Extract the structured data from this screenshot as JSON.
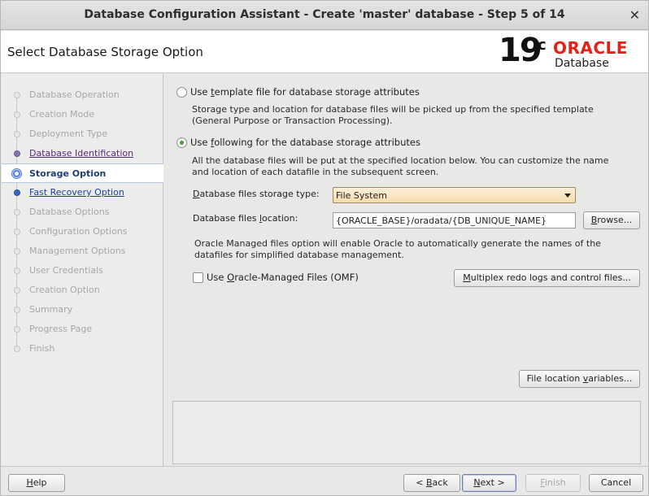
{
  "window": {
    "title": "Database Configuration Assistant - Create 'master' database - Step 5 of 14",
    "close_glyph": "✕"
  },
  "header": {
    "page_title": "Select Database Storage Option",
    "logo": {
      "version": "19",
      "version_sup": "c",
      "brand": "ORACLE",
      "product": "Database"
    }
  },
  "sidebar": {
    "items": [
      {
        "label": "Database Operation",
        "state": "done"
      },
      {
        "label": "Creation Mode",
        "state": "done"
      },
      {
        "label": "Deployment Type",
        "state": "done"
      },
      {
        "label": "Database Identification",
        "state": "link"
      },
      {
        "label": "Storage Option",
        "state": "active"
      },
      {
        "label": "Fast Recovery Option",
        "state": "link"
      },
      {
        "label": "Database Options",
        "state": "disabled"
      },
      {
        "label": "Configuration Options",
        "state": "disabled"
      },
      {
        "label": "Management Options",
        "state": "disabled"
      },
      {
        "label": "User Credentials",
        "state": "disabled"
      },
      {
        "label": "Creation Option",
        "state": "disabled"
      },
      {
        "label": "Summary",
        "state": "disabled"
      },
      {
        "label": "Progress Page",
        "state": "disabled"
      },
      {
        "label": "Finish",
        "state": "disabled"
      }
    ]
  },
  "content": {
    "option_template": {
      "label_pre": "Use ",
      "label_mn": "t",
      "label_post": "emplate file for database storage attributes",
      "desc_line1": "Storage type and location for database files will be picked up from the specified template",
      "desc_line2": "(General Purpose or Transaction Processing).",
      "selected": false
    },
    "option_following": {
      "label_pre": "Use ",
      "label_mn": "f",
      "label_post": "ollowing for the database storage attributes",
      "desc_line1": "All the database files will be put at the specified location below. You can customize the name",
      "desc_line2": "and location of each datafile in the subsequent screen.",
      "selected": true
    },
    "storage_type": {
      "label_pre": "",
      "label_mn": "D",
      "label_post": "atabase files storage type:",
      "value": "File System"
    },
    "files_location": {
      "label_pre": "Database files ",
      "label_mn": "l",
      "label_post": "ocation:",
      "value": "{ORACLE_BASE}/oradata/{DB_UNIQUE_NAME}"
    },
    "browse_button": {
      "label_pre": "",
      "label_mn": "B",
      "label_post": "rowse..."
    },
    "omf_note": {
      "line1": "Oracle Managed files option will enable Oracle to automatically generate the names of the",
      "line2": "datafiles for simplified database management."
    },
    "omf_checkbox": {
      "label_pre": "Use ",
      "label_mn": "O",
      "label_post": "racle-Managed Files (OMF)",
      "checked": false
    },
    "multiplex_button": {
      "label_pre": "",
      "label_mn": "M",
      "label_post": "ultiplex redo logs and control files..."
    },
    "file_location_vars_button": {
      "label_pre": "File location ",
      "label_mn": "v",
      "label_post": "ariables..."
    }
  },
  "footer": {
    "help": {
      "label_pre": "",
      "label_mn": "H",
      "label_post": "elp"
    },
    "back": {
      "label_pre": "< ",
      "label_mn": "B",
      "label_post": "ack"
    },
    "next": {
      "label_pre": "",
      "label_mn": "N",
      "label_post": "ext >"
    },
    "finish": {
      "label_pre": "",
      "label_mn": "F",
      "label_post": "inish"
    },
    "cancel": {
      "label_pre": "Cancel",
      "label_mn": "",
      "label_post": ""
    }
  }
}
